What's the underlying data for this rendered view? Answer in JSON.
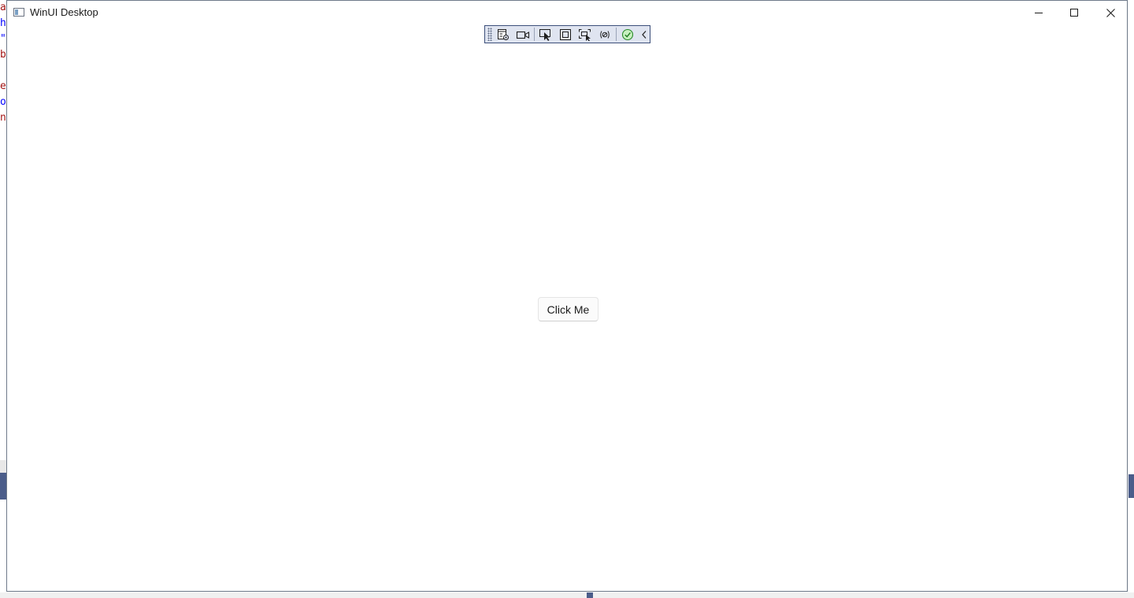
{
  "window": {
    "title": "WinUI Desktop"
  },
  "caption_buttons": {
    "minimize_icon": "minimize-icon",
    "maximize_icon": "maximize-icon",
    "close_icon": "close-icon"
  },
  "debug_toolbar": {
    "tools": [
      {
        "icon": "live-visual-tree-icon"
      },
      {
        "icon": "record-video-icon"
      },
      {
        "icon": "select-element-icon"
      },
      {
        "icon": "display-layout-adorners-icon"
      },
      {
        "icon": "track-focus-icon"
      },
      {
        "icon": "binding-failures-icon"
      },
      {
        "icon": "hot-reload-ok-icon"
      },
      {
        "icon": "collapse-toolbar-icon"
      }
    ]
  },
  "main": {
    "button_label": "Click Me"
  },
  "background": {
    "left_code_chars": [
      "a",
      "h",
      "\"",
      "b",
      "",
      "e",
      "o",
      "n"
    ],
    "accent_color": "#4b5d8a"
  }
}
